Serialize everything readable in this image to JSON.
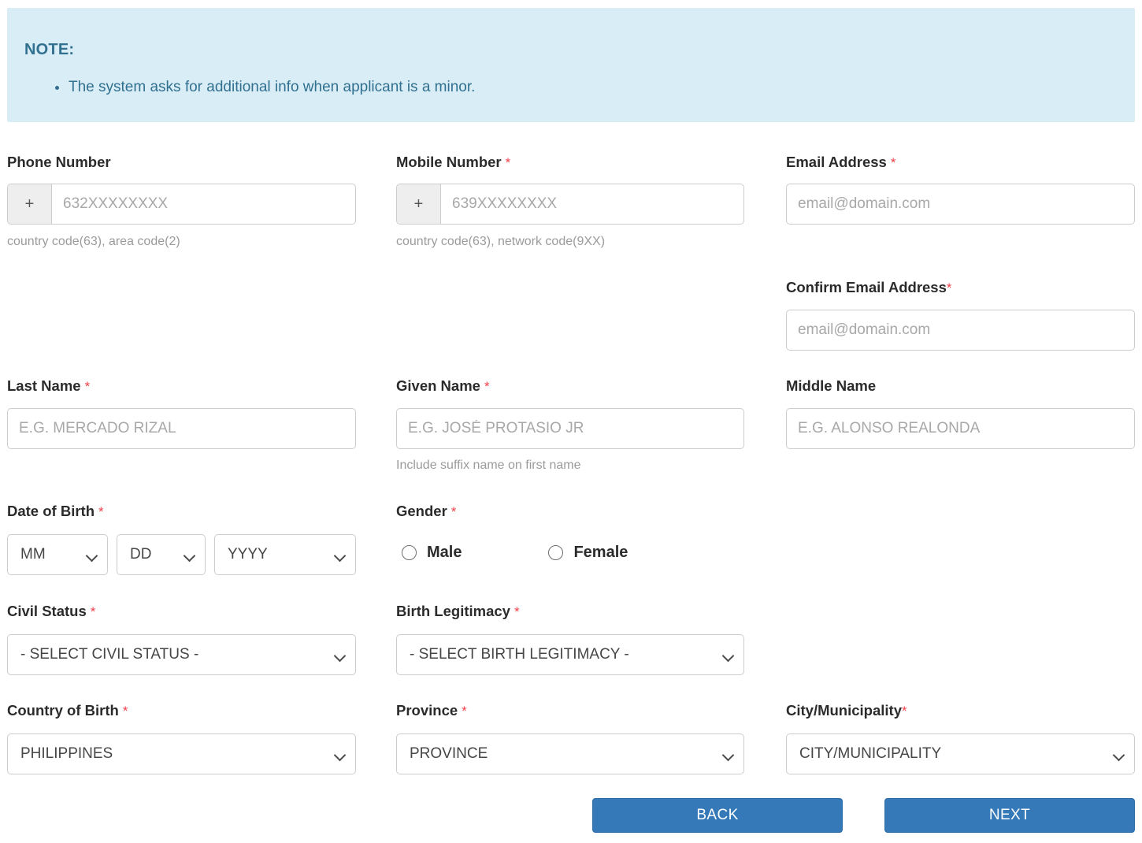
{
  "note": {
    "title": "NOTE:",
    "items": [
      "The system asks for additional info when applicant is a minor."
    ]
  },
  "form": {
    "phone_number": {
      "label": "Phone Number",
      "required": false,
      "prefix": "+",
      "placeholder": "632XXXXXXXX",
      "hint": "country code(63), area code(2)"
    },
    "mobile_number": {
      "label": "Mobile Number",
      "required": true,
      "required_mark": "*",
      "prefix": "+",
      "placeholder": "639XXXXXXXX",
      "hint": "country code(63), network code(9XX)"
    },
    "email_address": {
      "label": "Email Address",
      "required_mark": "*",
      "placeholder": "email@domain.com"
    },
    "confirm_email_address": {
      "label": "Confirm Email Address",
      "required_mark": "*",
      "placeholder": "email@domain.com"
    },
    "last_name": {
      "label": "Last Name",
      "required_mark": "*",
      "placeholder": "E.G. MERCADO RIZAL"
    },
    "given_name": {
      "label": "Given Name",
      "required_mark": "*",
      "placeholder": "E.G. JOSÉ PROTASIO JR",
      "hint": "Include suffix name on first name"
    },
    "middle_name": {
      "label": "Middle Name",
      "placeholder": "E.G. ALONSO REALONDA"
    },
    "date_of_birth": {
      "label": "Date of Birth",
      "required_mark": "*",
      "month": "MM",
      "day": "DD",
      "year": "YYYY"
    },
    "gender": {
      "label": "Gender",
      "required_mark": "*",
      "options": [
        "Male",
        "Female"
      ]
    },
    "civil_status": {
      "label": "Civil Status",
      "required_mark": "*",
      "value": "- SELECT CIVIL STATUS -"
    },
    "birth_legitimacy": {
      "label": "Birth Legitimacy",
      "required_mark": "*",
      "value": "- SELECT BIRTH LEGITIMACY -"
    },
    "country_of_birth": {
      "label": "Country of Birth",
      "required_mark": "*",
      "value": "PHILIPPINES"
    },
    "province": {
      "label": "Province",
      "required_mark": "*",
      "value": "PROVINCE"
    },
    "city_municipality": {
      "label": "City/Municipality",
      "required_mark": "*",
      "value": "CITY/MUNICIPALITY"
    }
  },
  "actions": {
    "back": "BACK",
    "next": "NEXT"
  },
  "colors": {
    "note_bg": "#d9edf7",
    "note_text": "#31708f",
    "required": "#f1414b",
    "button": "#3579b8"
  }
}
